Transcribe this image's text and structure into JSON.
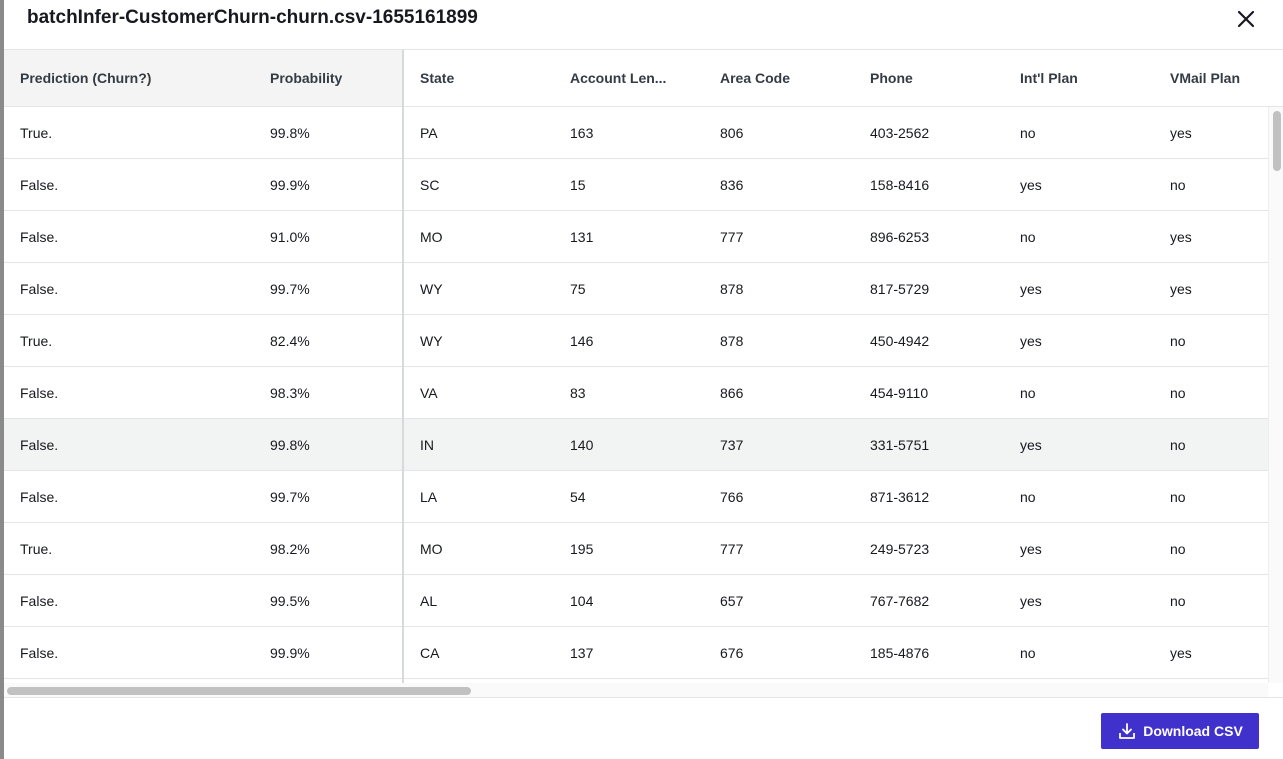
{
  "modal": {
    "title": "batchInfer-CustomerChurn-churn.csv-1655161899",
    "close_icon": "close-icon"
  },
  "table": {
    "columns": [
      "Prediction (Churn?)",
      "Probability",
      "State",
      "Account Len...",
      "Area Code",
      "Phone",
      "Int'l Plan",
      "VMail Plan"
    ],
    "rows": [
      [
        "True.",
        "99.8%",
        "PA",
        "163",
        "806",
        "403-2562",
        "no",
        "yes"
      ],
      [
        "False.",
        "99.9%",
        "SC",
        "15",
        "836",
        "158-8416",
        "yes",
        "no"
      ],
      [
        "False.",
        "91.0%",
        "MO",
        "131",
        "777",
        "896-6253",
        "no",
        "yes"
      ],
      [
        "False.",
        "99.7%",
        "WY",
        "75",
        "878",
        "817-5729",
        "yes",
        "yes"
      ],
      [
        "True.",
        "82.4%",
        "WY",
        "146",
        "878",
        "450-4942",
        "yes",
        "no"
      ],
      [
        "False.",
        "98.3%",
        "VA",
        "83",
        "866",
        "454-9110",
        "no",
        "no"
      ],
      [
        "False.",
        "99.8%",
        "IN",
        "140",
        "737",
        "331-5751",
        "yes",
        "no"
      ],
      [
        "False.",
        "99.7%",
        "LA",
        "54",
        "766",
        "871-3612",
        "no",
        "no"
      ],
      [
        "True.",
        "98.2%",
        "MO",
        "195",
        "777",
        "249-5723",
        "yes",
        "no"
      ],
      [
        "False.",
        "99.5%",
        "AL",
        "104",
        "657",
        "767-7682",
        "yes",
        "no"
      ],
      [
        "False.",
        "99.9%",
        "CA",
        "137",
        "676",
        "185-4876",
        "no",
        "yes"
      ]
    ]
  },
  "footer": {
    "download_label": "Download CSV",
    "download_icon": "download-icon",
    "accent_color": "#4031cd"
  }
}
